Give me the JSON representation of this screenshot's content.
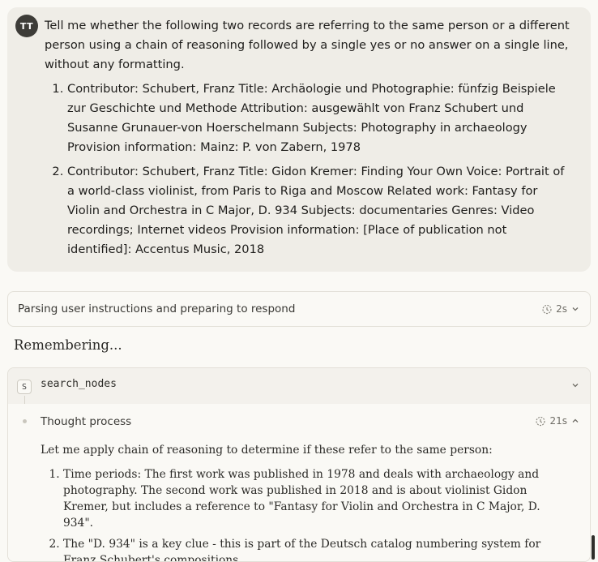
{
  "user": {
    "avatar_initials": "TT",
    "intro": "Tell me whether the following two records are referring to the same person or a different person using a chain of reasoning followed by a single yes or no answer on a single line, without any formatting.",
    "records": [
      "Contributor: Schubert, Franz Title: Archäologie und Photographie: fünfzig Beispiele zur Geschichte und Methode Attribution: ausgewählt von Franz Schubert und Susanne Grunauer-von Hoerschelmann Subjects: Photography in archaeology Provision information: Mainz: P. von Zabern, 1978",
      "Contributor: Schubert, Franz Title: Gidon Kremer: Finding Your Own Voice: Portrait of a world-class violinist, from Paris to Riga and Moscow Related work: Fantasy for Violin and Orchestra in C Major, D. 934 Subjects: documentaries Genres: Video recordings; Internet videos Provision information: [Place of publication not identified]: Accentus Music, 2018"
    ]
  },
  "status": {
    "text": "Parsing user instructions and preparing to respond",
    "duration": "2s",
    "icon": "timer-icon"
  },
  "remembering_label": "Remembering...",
  "tool": {
    "badge": "S",
    "name": "search_nodes",
    "icon": "chevron-down-icon"
  },
  "thought": {
    "title": "Thought process",
    "duration": "21s",
    "intro": "Let me apply chain of reasoning to determine if these refer to the same person:",
    "points": [
      "Time periods: The first work was published in 1978 and deals with archaeology and photography. The second work was published in 2018 and is about violinist Gidon Kremer, but includes a reference to \"Fantasy for Violin and Orchestra in C Major, D. 934\".",
      "The \"D. 934\" is a key clue - this is part of the Deutsch catalog numbering system for Franz Schubert's compositions."
    ]
  },
  "colors": {
    "background": "#faf9f5",
    "user_bubble": "#efede7",
    "avatar": "#3d3c38"
  }
}
